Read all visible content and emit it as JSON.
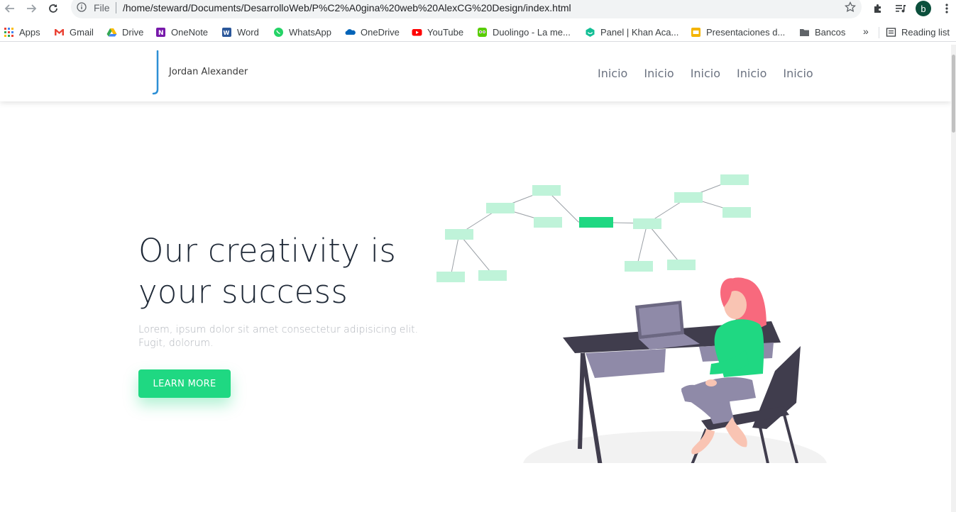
{
  "browser": {
    "scheme": "File",
    "url": "/home/steward/Documents/DesarrolloWeb/P%C2%A0gina%20web%20AlexCG%20Design/index.html",
    "profile_initial": "b",
    "bookmarks": [
      {
        "label": "Apps",
        "icon": "apps-grid-icon",
        "color": "#ea4335"
      },
      {
        "label": "Gmail",
        "icon": "gmail-icon",
        "color": "#ea4335"
      },
      {
        "label": "Drive",
        "icon": "drive-icon",
        "color": "#fbbc04"
      },
      {
        "label": "OneNote",
        "icon": "onenote-icon",
        "color": "#7719aa"
      },
      {
        "label": "Word",
        "icon": "word-icon",
        "color": "#2b579a"
      },
      {
        "label": "WhatsApp",
        "icon": "whatsapp-icon",
        "color": "#25d366"
      },
      {
        "label": "OneDrive",
        "icon": "onedrive-icon",
        "color": "#0364b8"
      },
      {
        "label": "YouTube",
        "icon": "youtube-icon",
        "color": "#ff0000"
      },
      {
        "label": "Duolingo - La me...",
        "icon": "duolingo-icon",
        "color": "#58cc02"
      },
      {
        "label": "Panel | Khan Aca...",
        "icon": "khan-academy-icon",
        "color": "#14bf96"
      },
      {
        "label": "Presentaciones d...",
        "icon": "slides-icon",
        "color": "#f4b400"
      },
      {
        "label": "Bancos",
        "icon": "folder-icon",
        "color": "#5f6368"
      }
    ],
    "more": "»",
    "reading_list": "Reading list"
  },
  "site": {
    "brand": "Jordan Alexander",
    "menu": [
      "Inicio",
      "Inicio",
      "Inicio",
      "Inicio",
      "Inicio"
    ],
    "hero": {
      "title_line1": "Our creativity is",
      "title_line2": "your success",
      "text_line1": "Lorem, ipsum dolor sit amet consectetur adipisicing elit.",
      "text_line2": "Fugit, dolorum.",
      "cta": "LEARN MORE"
    },
    "colors": {
      "accent": "#1fd882",
      "logo_line": "#2d8fd5",
      "title": "#1f2937",
      "muted": "#b0b4bb",
      "hair": "#f8697d",
      "desk": "#403d4d"
    }
  }
}
